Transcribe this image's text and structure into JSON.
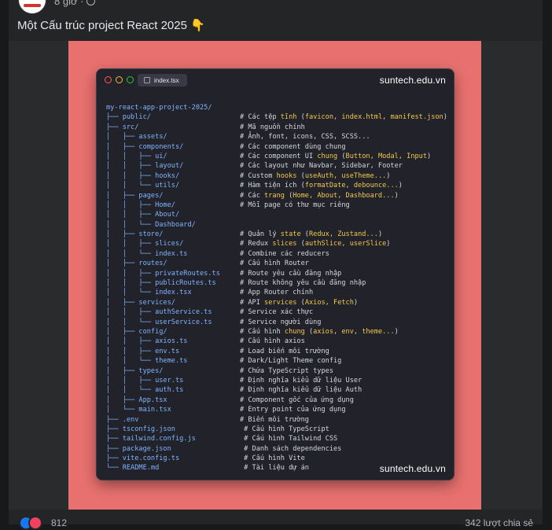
{
  "post": {
    "time": "8 giờ ·",
    "caption": "Một Cấu trúc project React 2025 👇"
  },
  "image": {
    "tab_label": "index.tsx",
    "site_top": "suntech.edu.vn",
    "site_bottom": "suntech.edu.vn",
    "lines": [
      {
        "tree": "my-react-app-project-2025/",
        "comment": []
      },
      {
        "tree": "├── public/",
        "comment": [
          {
            "t": "# Các tệp "
          },
          {
            "t": "tĩnh",
            "h": true
          },
          {
            "t": " ("
          },
          {
            "t": "favicon, index.html, manifest.json",
            "h": true
          },
          {
            "t": ")"
          }
        ]
      },
      {
        "tree": "├── src/",
        "comment": [
          {
            "t": "# Mã nguồn chính"
          }
        ]
      },
      {
        "tree": "│   ├── assets/",
        "comment": [
          {
            "t": "# Ảnh, font, icons, CSS, SCSS..."
          }
        ]
      },
      {
        "tree": "│   ├── components/",
        "comment": [
          {
            "t": "# Các component dùng chung"
          }
        ]
      },
      {
        "tree": "│   │   ├── ui/",
        "comment": [
          {
            "t": "# Các component UI "
          },
          {
            "t": "chung",
            "h": true
          },
          {
            "t": " ("
          },
          {
            "t": "Button, Modal, Input",
            "h": true
          },
          {
            "t": ")"
          }
        ]
      },
      {
        "tree": "│   │   ├── layout/",
        "comment": [
          {
            "t": "# Các layout như Navbar, Sidebar, Footer"
          }
        ]
      },
      {
        "tree": "│   │   ├── hooks/",
        "comment": [
          {
            "t": "# Custom "
          },
          {
            "t": "hooks",
            "h": true
          },
          {
            "t": " ("
          },
          {
            "t": "useAuth, useTheme...",
            "h": true
          },
          {
            "t": ")"
          }
        ]
      },
      {
        "tree": "│   │   └── utils/",
        "comment": [
          {
            "t": "# Hàm tiện ích ("
          },
          {
            "t": "formatDate, debounce...",
            "h": true
          },
          {
            "t": ")"
          }
        ]
      },
      {
        "tree": "│   ├── pages/",
        "comment": [
          {
            "t": "# Các "
          },
          {
            "t": "trang",
            "h": true
          },
          {
            "t": " ("
          },
          {
            "t": "Home, About, Dashboard...",
            "h": true
          },
          {
            "t": ")"
          }
        ]
      },
      {
        "tree": "│   │   ├── Home/",
        "comment": [
          {
            "t": "# Mỗi page có thư mục riêng"
          }
        ]
      },
      {
        "tree": "│   │   ├── About/",
        "comment": []
      },
      {
        "tree": "│   │   └── Dashboard/",
        "comment": []
      },
      {
        "tree": "│   ├── store/",
        "comment": [
          {
            "t": "# Quản lý "
          },
          {
            "t": "state",
            "h": true
          },
          {
            "t": " ("
          },
          {
            "t": "Redux, Zustand...",
            "h": true
          },
          {
            "t": ")"
          }
        ]
      },
      {
        "tree": "│   │   ├── slices/",
        "comment": [
          {
            "t": "# Redux "
          },
          {
            "t": "slices",
            "h": true
          },
          {
            "t": " ("
          },
          {
            "t": "authSlice, userSlice",
            "h": true
          },
          {
            "t": ")"
          }
        ]
      },
      {
        "tree": "│   │   └── index.ts",
        "comment": [
          {
            "t": "# Combine các reducers"
          }
        ]
      },
      {
        "tree": "│   ├── routes/",
        "comment": [
          {
            "t": "# Cấu hình Router"
          }
        ]
      },
      {
        "tree": "│   │   ├── privateRoutes.ts",
        "comment": [
          {
            "t": "# Route yêu cầu đăng nhập"
          }
        ]
      },
      {
        "tree": "│   │   ├── publicRoutes.ts",
        "comment": [
          {
            "t": "# Route không yêu cầu đăng nhập"
          }
        ]
      },
      {
        "tree": "│   │   └── index.tsx",
        "comment": [
          {
            "t": "# App Router chính"
          }
        ]
      },
      {
        "tree": "│   ├── services/",
        "comment": [
          {
            "t": "# API "
          },
          {
            "t": "services",
            "h": true
          },
          {
            "t": " ("
          },
          {
            "t": "Axios, Fetch",
            "h": true
          },
          {
            "t": ")"
          }
        ]
      },
      {
        "tree": "│   │   ├── authService.ts",
        "comment": [
          {
            "t": "# Service xác thực"
          }
        ]
      },
      {
        "tree": "│   │   └── userService.ts",
        "comment": [
          {
            "t": "# Service người dùng"
          }
        ]
      },
      {
        "tree": "│   ├── config/",
        "comment": [
          {
            "t": "# Cấu hình "
          },
          {
            "t": "chung",
            "h": true
          },
          {
            "t": " ("
          },
          {
            "t": "axios, env, theme...",
            "h": true
          },
          {
            "t": ")"
          }
        ]
      },
      {
        "tree": "│   │   ├── axios.ts",
        "comment": [
          {
            "t": "# Cấu hình axios"
          }
        ]
      },
      {
        "tree": "│   │   ├── env.ts",
        "comment": [
          {
            "t": "# Load biến môi trường"
          }
        ]
      },
      {
        "tree": "│   │   └── theme.ts",
        "comment": [
          {
            "t": "# Dark/Light Theme config"
          }
        ]
      },
      {
        "tree": "│   ├── types/",
        "comment": [
          {
            "t": "# Chứa TypeScript types"
          }
        ]
      },
      {
        "tree": "│   │   ├── user.ts",
        "comment": [
          {
            "t": "# Định nghĩa kiểu dữ liệu User"
          }
        ]
      },
      {
        "tree": "│   │   └── auth.ts",
        "comment": [
          {
            "t": "# Định nghĩa kiểu dữ liệu Auth"
          }
        ]
      },
      {
        "tree": "│   ├── App.tsx",
        "comment": [
          {
            "t": "# Component gốc của ứng dụng"
          }
        ]
      },
      {
        "tree": "│   └── main.tsx",
        "comment": [
          {
            "t": "# Entry point của ứng dụng"
          }
        ]
      },
      {
        "tree": "├── .env",
        "comment": [
          {
            "t": "# Biến môi trường"
          }
        ]
      },
      {
        "tree": "├── tsconfig.json",
        "comment": [
          {
            "t": " # Cấu hình TypeScript"
          }
        ]
      },
      {
        "tree": "├── tailwind.config.js",
        "comment": [
          {
            "t": " # Cấu hình Tailwind CSS"
          }
        ]
      },
      {
        "tree": "├── package.json",
        "comment": [
          {
            "t": " # Danh sách dependencies"
          }
        ]
      },
      {
        "tree": "├── vite.config.ts",
        "comment": [
          {
            "t": " # Cấu hình Vite"
          }
        ]
      },
      {
        "tree": "└── README.md",
        "comment": [
          {
            "t": " # Tài liệu dự án"
          }
        ]
      }
    ]
  },
  "reactions": {
    "count": "812",
    "shares": "342 lượt chia sẻ"
  },
  "colors": {
    "page_bg": "#18191a",
    "card_bg": "#242526",
    "pink_bg": "#e8716f",
    "terminal_bg": "#22222a",
    "tree_blue": "#7fb5ff",
    "highlight_yellow": "#f2c94c"
  }
}
